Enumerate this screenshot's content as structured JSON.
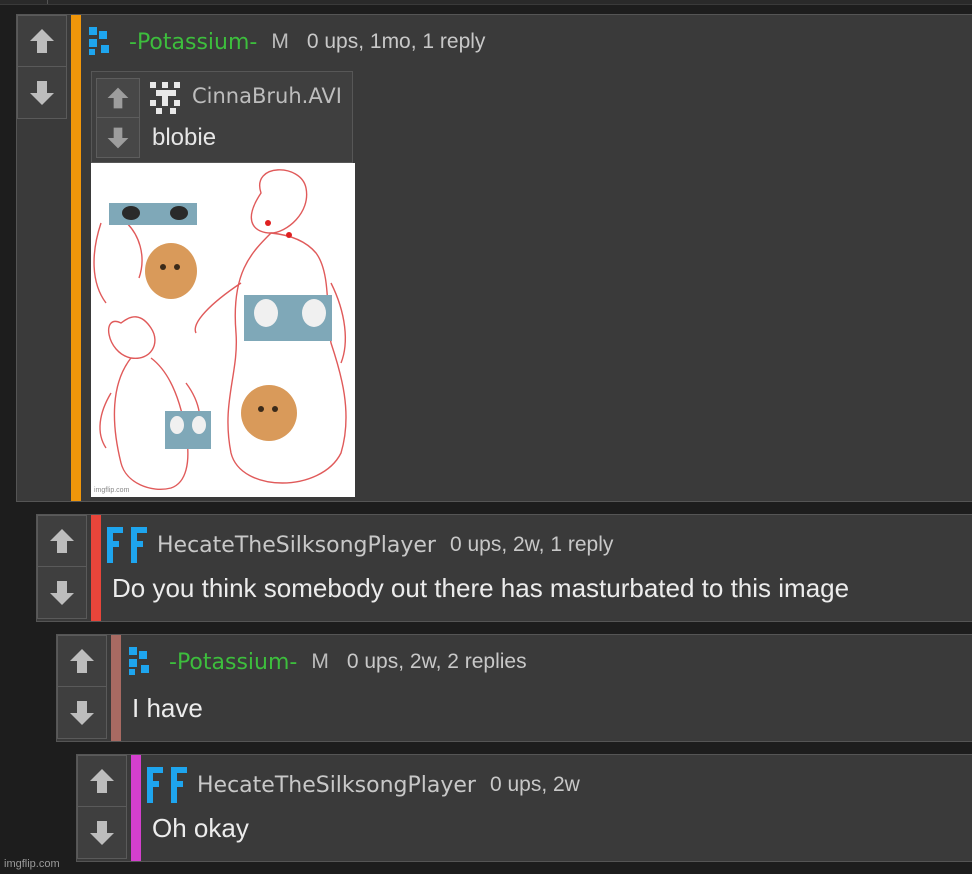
{
  "watermark": "imgflip.com",
  "comments": [
    {
      "user": "-Potassium-",
      "mod_badge": "M",
      "meta": "0 ups, 1mo, 1 reply",
      "name_color": "#3dbe3d",
      "bar_color": "#f0960a",
      "embedded": {
        "user": "CinnaBruh.AVI",
        "text": "blobie",
        "image_watermark": "imgflip.com"
      }
    },
    {
      "user": "HecateTheSilksongPlayer",
      "meta": "0 ups, 2w, 1 reply",
      "text": "Do you think somebody out there has masturbated to this image",
      "name_color": "#c8c8c8",
      "bar_color": "#e8453a"
    },
    {
      "user": "-Potassium-",
      "mod_badge": "M",
      "meta": "0 ups, 2w, 2 replies",
      "text": "I have",
      "name_color": "#3dbe3d",
      "bar_color": "#a86a62"
    },
    {
      "user": "HecateTheSilksongPlayer",
      "meta": "0 ups, 2w",
      "text": "Oh okay",
      "name_color": "#c8c8c8",
      "bar_color": "#d43fce"
    }
  ],
  "icons": {
    "upvote": "arrow-up-icon",
    "downvote": "arrow-down-icon"
  }
}
